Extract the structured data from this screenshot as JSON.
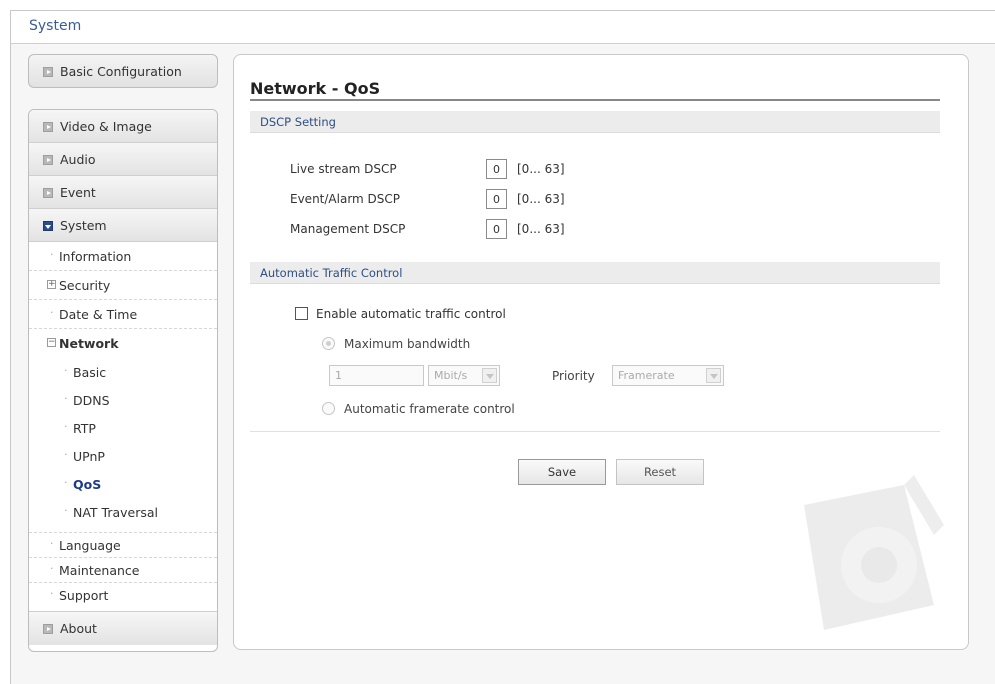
{
  "header": {
    "title": "System"
  },
  "sidebar": {
    "basic_config": "Basic Configuration",
    "video_image": "Video & Image",
    "audio": "Audio",
    "event": "Event",
    "system": "System",
    "system_items": {
      "information": "Information",
      "security": "Security",
      "date_time": "Date & Time",
      "network": "Network",
      "network_items": [
        "Basic",
        "DDNS",
        "RTP",
        "UPnP",
        "QoS",
        "NAT Traversal"
      ],
      "language": "Language",
      "maintenance": "Maintenance",
      "support": "Support"
    },
    "about": "About",
    "active_item": "QoS"
  },
  "main": {
    "title": "Network - QoS",
    "dscp": {
      "section_title": "DSCP Setting",
      "rows": [
        {
          "label": "Live stream DSCP",
          "value": "0",
          "range": "[0... 63]"
        },
        {
          "label": "Event/Alarm DSCP",
          "value": "0",
          "range": "[0... 63]"
        },
        {
          "label": "Management DSCP",
          "value": "0",
          "range": "[0... 63]"
        }
      ]
    },
    "traffic": {
      "section_title": "Automatic Traffic Control",
      "enable_label": "Enable automatic traffic control",
      "max_bandwidth_label": "Maximum bandwidth",
      "bandwidth_value": "1",
      "bandwidth_unit": "Mbit/s",
      "priority_label": "Priority",
      "priority_value": "Framerate",
      "auto_framerate_label": "Automatic framerate control"
    },
    "buttons": {
      "save": "Save",
      "reset": "Reset"
    }
  },
  "colors": {
    "link_blue": "#3b5b9a",
    "active_blue": "#1e3a8a",
    "section_bg": "#ececec"
  }
}
